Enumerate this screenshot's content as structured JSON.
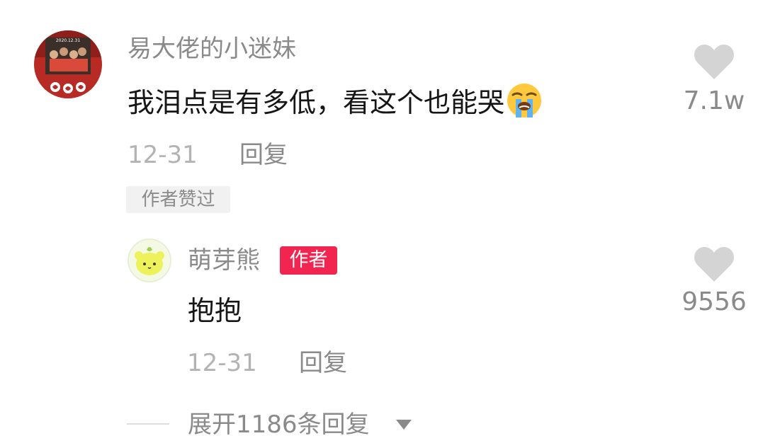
{
  "comments": [
    {
      "username": "易大佬的小迷妹",
      "text": "我泪点是有多低，看这个也能哭",
      "emoji": "loudly-crying-face",
      "date": "12-31",
      "reply_label": "回复",
      "author_liked_label": "作者赞过",
      "like_count": "7.1w",
      "avatar_banner_text": "2020.12.31"
    }
  ],
  "reply": {
    "username": "萌芽熊",
    "author_badge": "作者",
    "text": "抱抱",
    "date": "12-31",
    "reply_label": "回复",
    "like_count": "9556"
  },
  "expand": {
    "label": "展开1186条回复",
    "icon": "triangle-down-icon"
  },
  "colors": {
    "author_badge_bg": "#f1254f",
    "heart": "#d4d4d4",
    "secondary_text": "#8a8a8a",
    "date_text": "#b3b3b3",
    "primary_text": "#161616"
  }
}
